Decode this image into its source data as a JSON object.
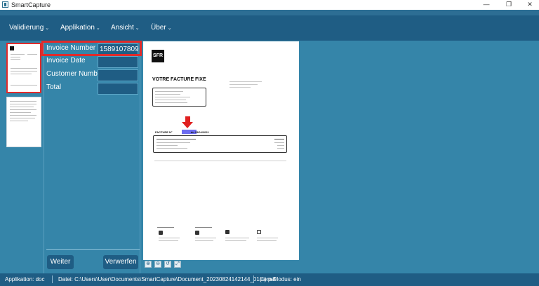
{
  "window": {
    "title": "SmartCapture",
    "controls": {
      "minimize": "—",
      "maximize": "❐",
      "close": "✕"
    }
  },
  "menu": [
    {
      "label": "Validierung"
    },
    {
      "label": "Applikation"
    },
    {
      "label": "Ansicht"
    },
    {
      "label": "Über"
    }
  ],
  "fields": [
    {
      "label": "Invoice Number",
      "value": "1589107809"
    },
    {
      "label": "Invoice Date",
      "value": ""
    },
    {
      "label": "Customer Number",
      "value": ""
    },
    {
      "label": "Total",
      "value": ""
    }
  ],
  "buttons": {
    "next": "Weiter",
    "discard": "Verwerfen"
  },
  "document": {
    "logo": "SFR",
    "heading": "VOTRE FACTURE FIXE",
    "facture_prefix": "FACTURE N°",
    "facture_suffix": "du 25/04/2021"
  },
  "viewer_tools": [
    "⊕",
    "⊖",
    "↺",
    "⤢"
  ],
  "status": {
    "application": "Applikation: doc",
    "file": "Datei: C:\\Users\\User\\Documents\\SmartCapture\\Document_20230824142144_01(1).pdf",
    "learn_mode": "Lern-Modus: ein"
  },
  "colors": {
    "header": "#1f5d84",
    "workspace": "#3585a9",
    "highlight": "#e02b2b"
  }
}
